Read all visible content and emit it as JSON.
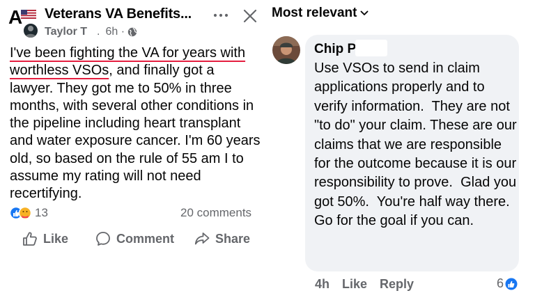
{
  "post": {
    "group_name": "Veterans VA Benefits...",
    "group_logo_letter": "A",
    "author": "Taylor T",
    "separator": ".",
    "time": "6h ·",
    "text_underlined": "I've been fighting the VA for years with worthless VSOs",
    "text_rest": ", and finally got a lawyer. They got me to 50% in three months, with several other conditions in the pipeline including heart transplant and water exposure cancer.  I'm 60 years old, so based on the rule of 55 am I to assume my rating will not need recertifying.",
    "reaction_count": "13",
    "comments_count": "20 comments",
    "actions": {
      "like": "Like",
      "comment": "Comment",
      "share": "Share"
    }
  },
  "comments": {
    "sort_label": "Most relevant",
    "items": [
      {
        "author": "Chip P",
        "text": "Use VSOs to send in claim applications properly and to verify information.  They are not \"to do\" your claim. These are our claims that we are responsible for the outcome because it is our responsibility to prove.  Glad you got 50%.  You're half way there.  Go for the goal if you can.",
        "timestamp": "4h",
        "like_label": "Like",
        "reply_label": "Reply",
        "reaction_count": "6"
      }
    ]
  },
  "colors": {
    "text_primary": "#050505",
    "text_secondary": "#65676b",
    "like_blue": "#1877f2",
    "underline_red": "#e41e3f",
    "bubble_bg": "#f0f2f5"
  },
  "icons": {
    "more": "more-horizontal-icon",
    "close": "close-icon",
    "globe": "globe-icon",
    "like": "thumbs-up-icon",
    "comment": "speech-bubble-icon",
    "share": "share-arrow-icon",
    "sort": "chevron-down-icon"
  }
}
